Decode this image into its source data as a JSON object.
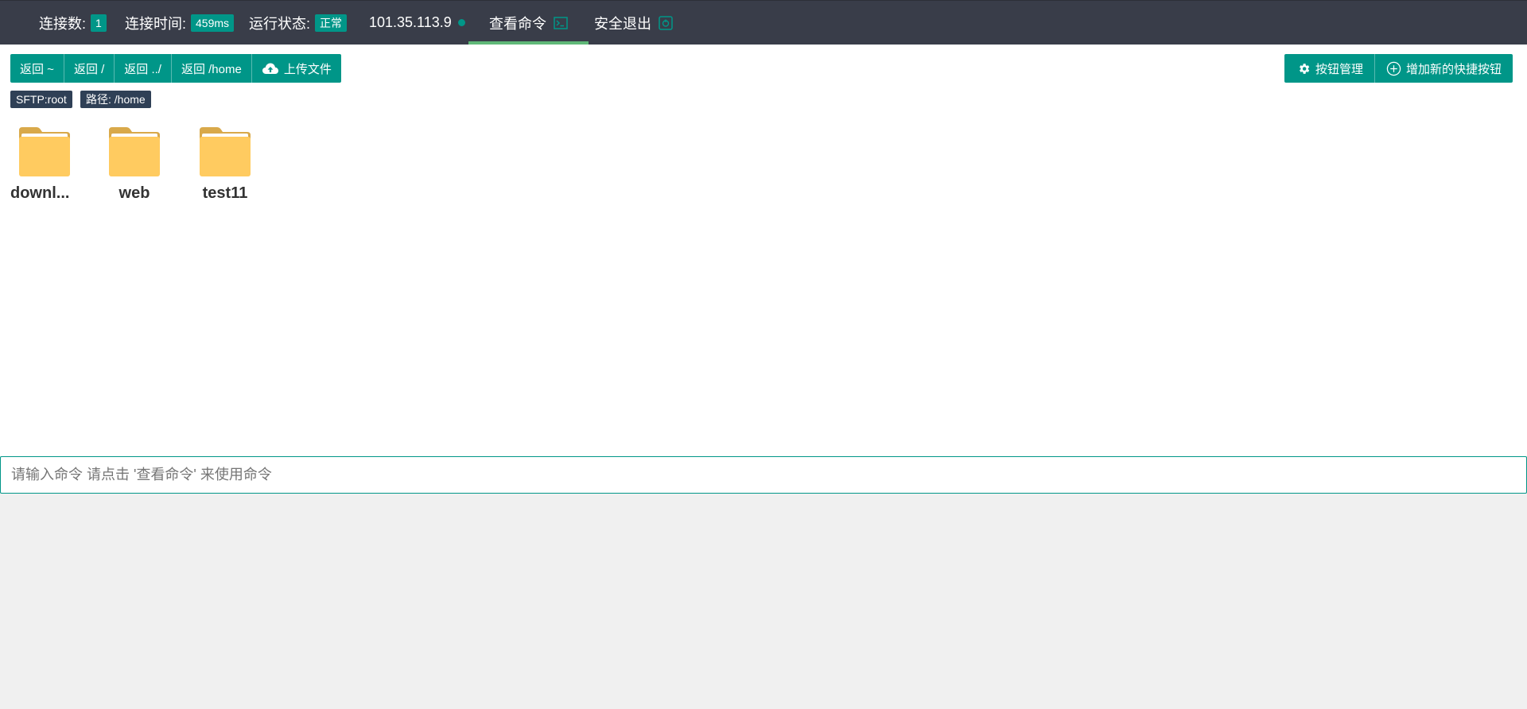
{
  "topbar": {
    "connections_label": "连接数:",
    "connections_value": "1",
    "conn_time_label": "连接时间:",
    "conn_time_value": "459ms",
    "status_label": "运行状态:",
    "status_value": "正常",
    "host_ip": "101.35.113.9",
    "view_command_label": "查看命令",
    "logout_label": "安全退出"
  },
  "toolbar": {
    "nav_buttons": [
      "返回 ~",
      "返回 /",
      "返回 ../",
      "返回 /home"
    ],
    "upload_label": "上传文件",
    "manage_buttons_label": "按钮管理",
    "add_shortcut_label": "增加新的快捷按钮"
  },
  "info": {
    "sftp_tag": "SFTP:root",
    "path_tag": "路径: /home"
  },
  "files": [
    {
      "name": "downl...",
      "type": "folder"
    },
    {
      "name": "web",
      "type": "folder"
    },
    {
      "name": "test11",
      "type": "folder"
    }
  ],
  "command": {
    "placeholder": "请输入命令 请点击 '查看命令' 来使用命令"
  },
  "colors": {
    "topbar_bg": "#393d49",
    "accent": "#009688",
    "tab_underline": "#5fb878",
    "tag_bg": "#2f4056",
    "folder": "#ffcb60"
  },
  "icons": {
    "view_command": "terminal-icon",
    "logout": "power-icon",
    "upload": "cloud-upload-icon",
    "manage": "gear-icon",
    "add": "plus-circle-icon",
    "file": "folder-icon"
  }
}
